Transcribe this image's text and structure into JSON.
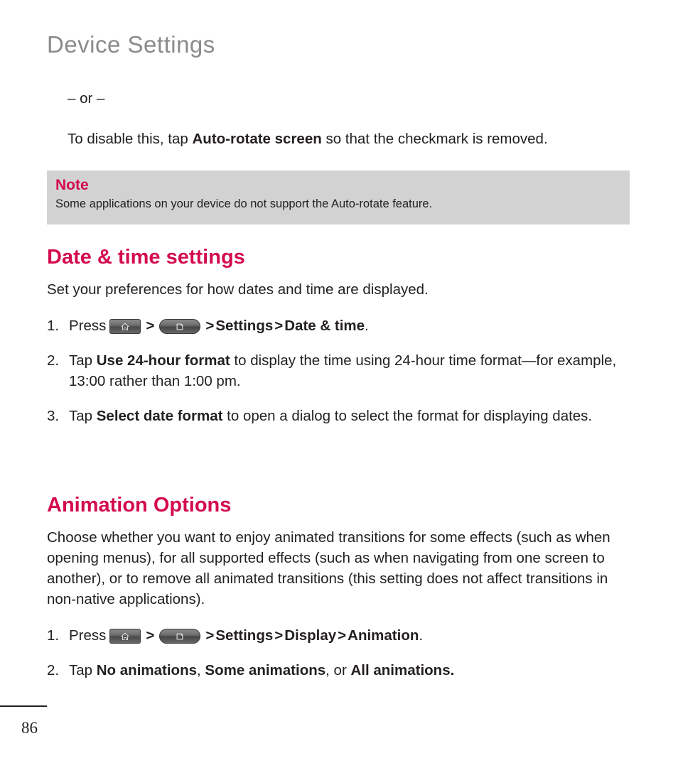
{
  "document": {
    "running_header": "Device Settings",
    "page_number": "86"
  },
  "intro": {
    "or_divider": "– or –",
    "disable_line": {
      "before": "To disable this, tap ",
      "bold": "Auto-rotate screen",
      "after": " so that the checkmark is removed."
    }
  },
  "note": {
    "title": "Note",
    "body": "Some applications on your device do not support the Auto-rotate feature."
  },
  "date_time_section": {
    "heading": "Date & time settings",
    "intro": "Set your preferences for how dates and time are displayed.",
    "steps": [
      {
        "number": "1.",
        "prefix": "Press",
        "keys": [
          "home-key",
          "menu-key"
        ],
        "separator": ">",
        "trail_bold_1": "Settings",
        "trail_sep": ">",
        "trail_bold_2": "Date & time",
        "trail_end": "."
      },
      {
        "number": "2.",
        "before": "Tap ",
        "bold": "Use 24-hour format",
        "after": " to display the time using 24-hour time format—for example, 13:00 rather than 1:00 pm."
      },
      {
        "number": "3.",
        "before": "Tap ",
        "bold": "Select date format",
        "after": " to open a dialog to select the format for displaying dates."
      }
    ]
  },
  "animation_section": {
    "heading": "Animation Options",
    "intro": "Choose whether you want to enjoy animated transitions for some effects (such as when opening menus), for all supported effects (such as when navigating from one screen to another), or to remove all animated transitions (this setting does not affect transitions in non-native applications).",
    "steps": [
      {
        "number": "1.",
        "prefix": "Press",
        "keys": [
          "home-key",
          "menu-key"
        ],
        "separator": ">",
        "trail_bold_1": "Settings",
        "trail_sep": ">",
        "trail_bold_2": "Display",
        "trail_sep_2": ">",
        "trail_bold_3": "Animation",
        "trail_end": "."
      },
      {
        "number": "2.",
        "before": "Tap ",
        "bold_1": "No animations",
        "mid_1": ", ",
        "bold_2": "Some animations",
        "mid_2": ", or ",
        "bold_3": "All animations."
      }
    ]
  },
  "colors": {
    "accent": "#d30b4d",
    "header_gray": "#8a8a8a",
    "note_background": "#d2d2d2",
    "body_text": "#231f20"
  }
}
